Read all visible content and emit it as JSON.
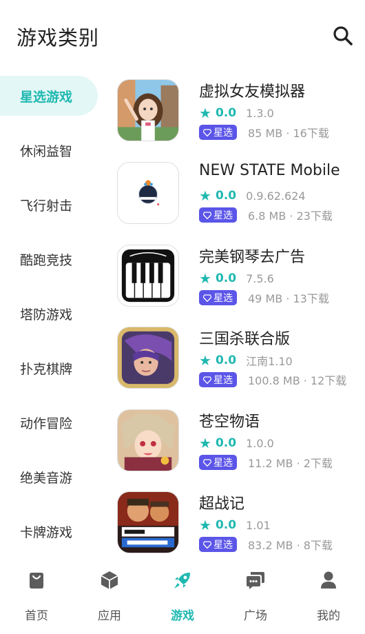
{
  "header": {
    "title": "游戏类别",
    "search_icon": "search-icon"
  },
  "categories": [
    {
      "label": "星选游戏",
      "active": true
    },
    {
      "label": "休闲益智",
      "active": false
    },
    {
      "label": "飞行射击",
      "active": false
    },
    {
      "label": "酷跑竞技",
      "active": false
    },
    {
      "label": "塔防游戏",
      "active": false
    },
    {
      "label": "扑克棋牌",
      "active": false
    },
    {
      "label": "动作冒险",
      "active": false
    },
    {
      "label": "绝美音游",
      "active": false
    },
    {
      "label": "卡牌游戏",
      "active": false
    }
  ],
  "games": [
    {
      "name": "虚拟女友模拟器",
      "score": "0.0",
      "version": "1.3.0",
      "badge": "星选",
      "meta": "85 MB · 16下载",
      "icon": "anime-girl-icon"
    },
    {
      "name": "NEW STATE Mobile",
      "score": "0.0",
      "version": "0.9.62.624",
      "badge": "星选",
      "meta": "6.8 MB · 23下载",
      "icon": "craft-logo-icon"
    },
    {
      "name": "完美钢琴去广告",
      "score": "0.0",
      "version": "7.5.6",
      "badge": "星选",
      "meta": "49 MB · 13下载",
      "icon": "piano-icon"
    },
    {
      "name": "三国杀联合版",
      "score": "0.0",
      "version": "江南1.10",
      "badge": "星选",
      "meta": "100.8 MB · 12下载",
      "icon": "warrior-portrait-icon"
    },
    {
      "name": "苍空物语",
      "score": "0.0",
      "version": "1.0.0",
      "badge": "星选",
      "meta": "11.2 MB · 2下载",
      "icon": "anime-character-icon"
    },
    {
      "name": "超战记",
      "score": "0.0",
      "version": "1.01",
      "badge": "星选",
      "meta": "83.2 MB · 8下载",
      "icon": "ultra-battle-icon"
    }
  ],
  "nav": [
    {
      "label": "首页",
      "icon": "shopping-bag-icon",
      "active": false
    },
    {
      "label": "应用",
      "icon": "cube-icon",
      "active": false
    },
    {
      "label": "游戏",
      "icon": "rocket-icon",
      "active": true
    },
    {
      "label": "广场",
      "icon": "chat-icon",
      "active": false
    },
    {
      "label": "我的",
      "icon": "person-icon",
      "active": false
    }
  ],
  "colors": {
    "accent": "#1fb8b0",
    "badge": "#5b55e8",
    "active_bg": "#e3f7f6",
    "muted": "#999999"
  }
}
